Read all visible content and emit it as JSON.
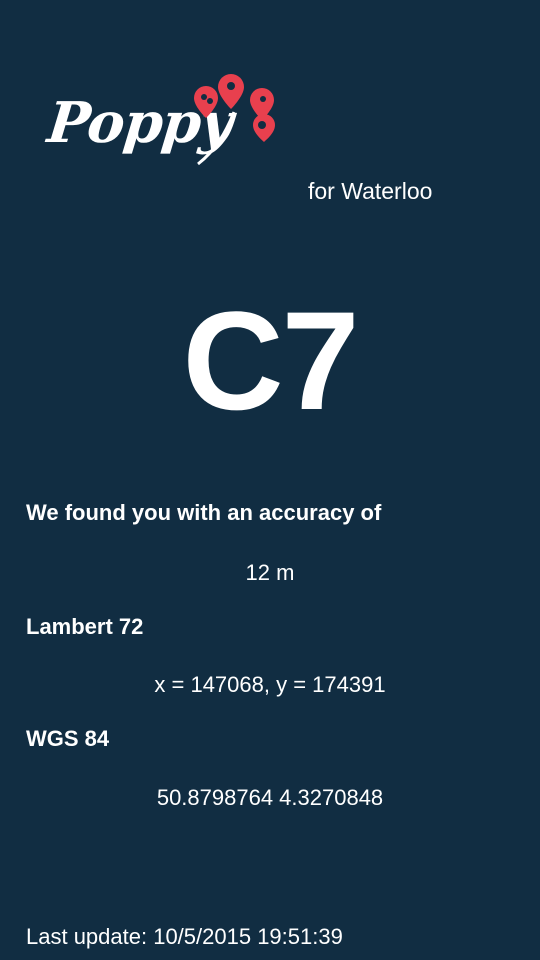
{
  "app": {
    "logo_text": "Poppy",
    "subtitle": "for Waterloo"
  },
  "location": {
    "grid_code": "C7",
    "accuracy_label": "We found you with an accuracy of",
    "accuracy_value": "12 m",
    "lambert_label": "Lambert 72",
    "lambert_value": "x = 147068, y = 174391",
    "wgs_label": "WGS 84",
    "wgs_value": "50.8798764 4.3270848"
  },
  "status": {
    "last_update": "Last update: 10/5/2015 19:51:39"
  },
  "colors": {
    "background": "#112d42",
    "text": "#ffffff",
    "accent": "#e8404e"
  },
  "icons": {
    "logo_flower": "map-pin-flower-icon"
  }
}
